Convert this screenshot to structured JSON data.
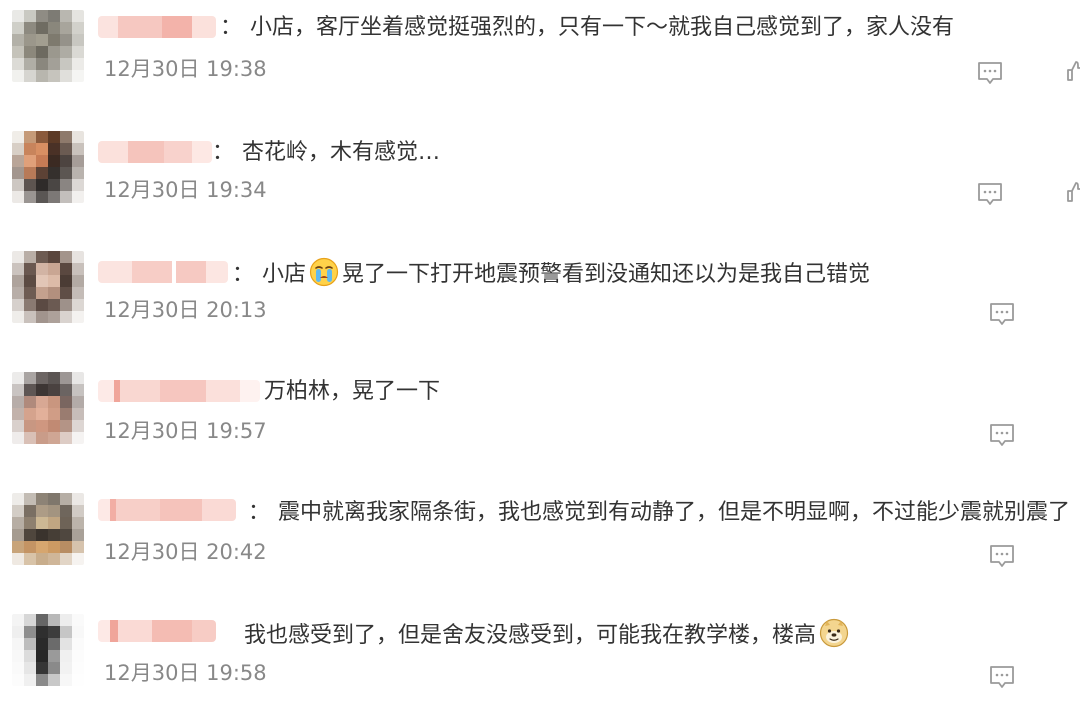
{
  "comments": [
    {
      "content": "小店，客厅坐着感觉挺强烈的，只有一下～就我自己感觉到了，家人没有",
      "separator": "：",
      "timestamp": "12月30日 19:38",
      "has_like": true
    },
    {
      "content": "杏花岭，木有感觉…",
      "separator": "：",
      "timestamp": "12月30日 19:34",
      "has_like": true
    },
    {
      "content_before": "小店",
      "emoji": "crying-face-emoji",
      "content_after": "晃了一下打开地震预警看到没通知还以为是我自己错觉",
      "separator": "：",
      "timestamp": "12月30日 20:13",
      "has_like": false
    },
    {
      "content": "万柏林，晃了一下",
      "separator": "",
      "timestamp": "12月30日 19:57",
      "has_like": false
    },
    {
      "content": "震中就离我家隔条街，我也感觉到有动静了，但是不明显啊，不过能少震就别震了",
      "separator": "：",
      "timestamp": "12月30日 20:42",
      "has_like": false
    },
    {
      "content_before": "我也感受到了，但是舍友没感受到，可能我在教学楼，楼高",
      "emoji": "doge-emoji",
      "content_after": "",
      "separator": "",
      "timestamp": "12月30日 19:58",
      "has_like": false
    }
  ],
  "icons": {
    "reply": "comment-reply-icon",
    "like": "thumbs-up-icon"
  },
  "colors": {
    "text": "#333333",
    "timestamp": "#888888",
    "blur_pink": "#f4b8b0",
    "icon_gray": "#9a9a9a"
  }
}
